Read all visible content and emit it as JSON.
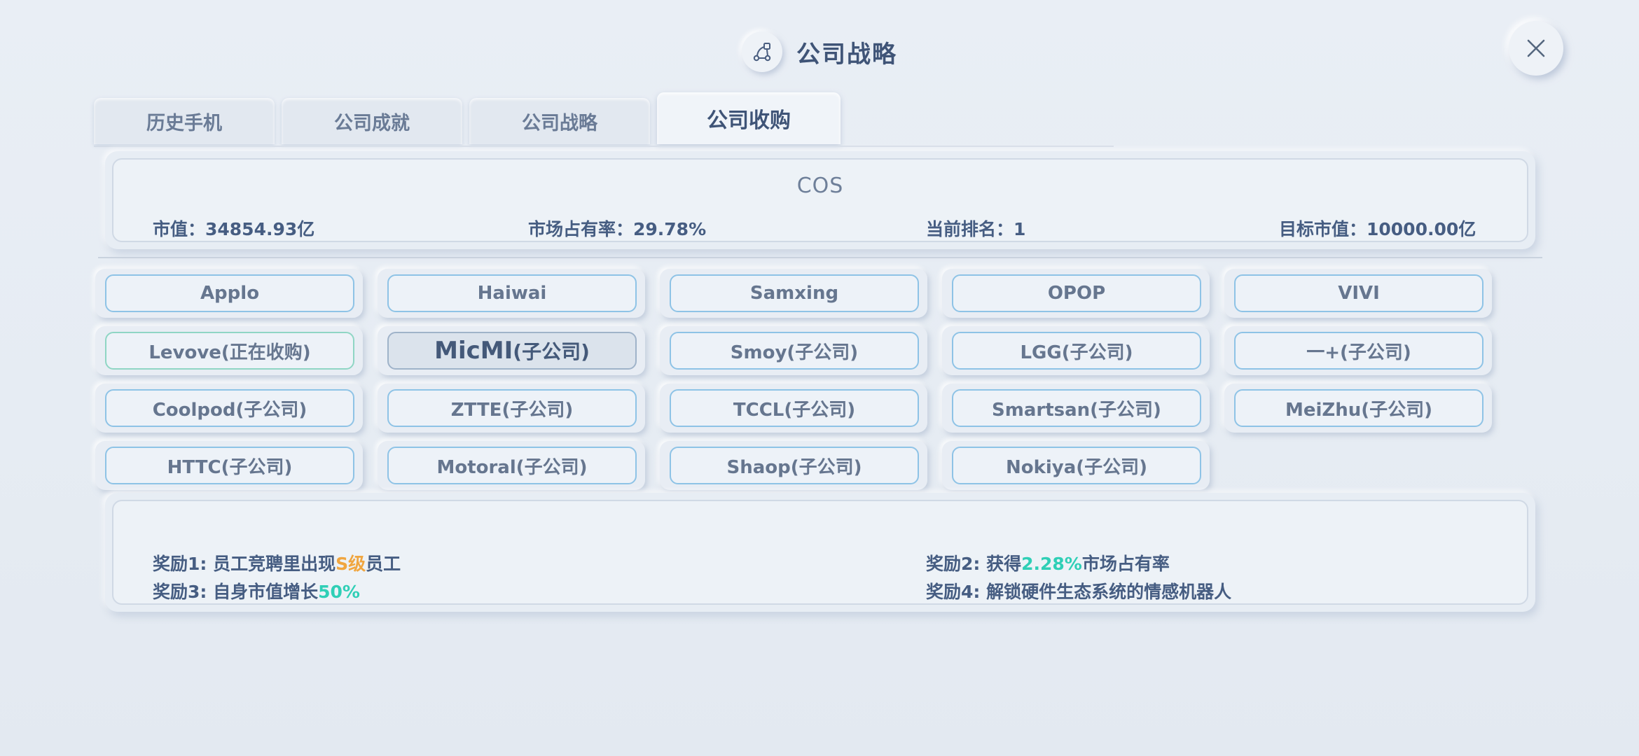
{
  "header": {
    "title": "公司战略",
    "icon": "strategy-nodes-icon",
    "close_icon": "close-icon"
  },
  "tabs": [
    {
      "label": "历史手机",
      "active": false
    },
    {
      "label": "公司成就",
      "active": false
    },
    {
      "label": "公司战略",
      "active": false
    },
    {
      "label": "公司收购",
      "active": true
    }
  ],
  "company": {
    "name": "COS",
    "market_value": "市值：34854.93亿",
    "market_share": "市场占有率：29.78%",
    "rank": "当前排名：1",
    "target_value": "目标市值：10000.00亿"
  },
  "companies": [
    {
      "label": "Applo",
      "status": "normal"
    },
    {
      "label": "Haiwai",
      "status": "normal"
    },
    {
      "label": "Samxing",
      "status": "normal"
    },
    {
      "label": "OPOP",
      "status": "normal"
    },
    {
      "label": "VIVI",
      "status": "normal"
    },
    {
      "label": "Levove(正在收购)",
      "status": "acquiring"
    },
    {
      "label": "MicMI",
      "suffix": "(子公司)",
      "status": "selected"
    },
    {
      "label": "Smoy(子公司)",
      "status": "subsidiary"
    },
    {
      "label": "LGG(子公司)",
      "status": "subsidiary"
    },
    {
      "label": "一+(子公司)",
      "status": "subsidiary"
    },
    {
      "label": "Coolpod(子公司)",
      "status": "subsidiary"
    },
    {
      "label": "ZTTE(子公司)",
      "status": "subsidiary"
    },
    {
      "label": "TCCL(子公司)",
      "status": "subsidiary"
    },
    {
      "label": "Smartsan(子公司)",
      "status": "subsidiary"
    },
    {
      "label": "MeiZhu(子公司)",
      "status": "subsidiary"
    },
    {
      "label": "HTTC(子公司)",
      "status": "subsidiary"
    },
    {
      "label": "Motoral(子公司)",
      "status": "subsidiary"
    },
    {
      "label": "Shaop(子公司)",
      "status": "subsidiary"
    },
    {
      "label": "Nokiya(子公司)",
      "status": "subsidiary"
    }
  ],
  "rewards": {
    "r1": {
      "prefix": "奖励1: 员工竞聘里出现",
      "highlight": "S级",
      "suffix": "员工"
    },
    "r2": {
      "prefix": "奖励2: 获得",
      "highlight": "2.28%",
      "suffix": "市场占有率"
    },
    "r3": {
      "prefix": "奖励3: 自身市值增长",
      "highlight": "50%",
      "suffix": ""
    },
    "r4": {
      "prefix": "奖励4: 解锁硬件生态系统的情感机器人",
      "highlight": "",
      "suffix": ""
    }
  },
  "colors": {
    "background": "#e7edf4",
    "title": "#3f5477",
    "button_border": "#8ec3e6",
    "acquiring_border": "#8fd6c4",
    "highlight_orange": "#f0a640",
    "highlight_teal": "#2fcfb6"
  }
}
